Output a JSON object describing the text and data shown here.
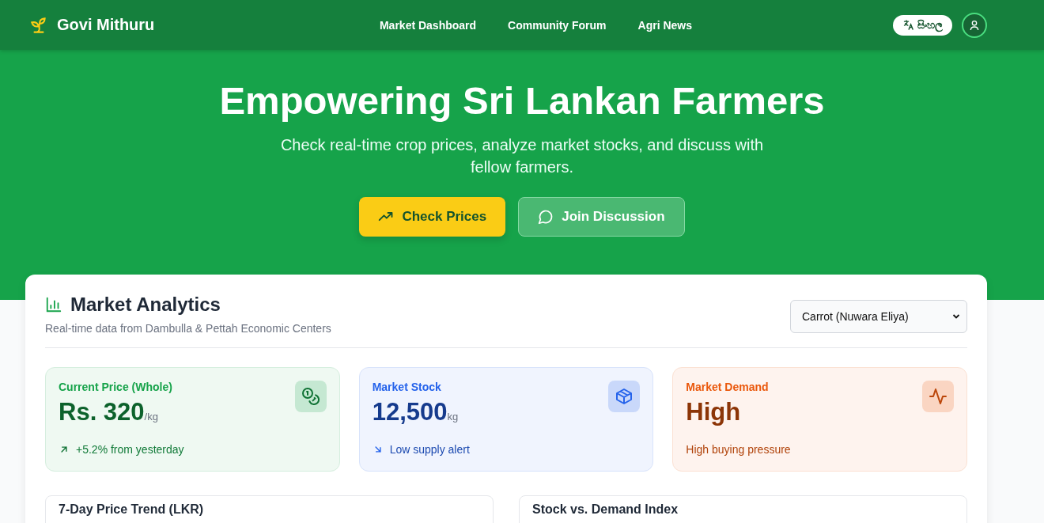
{
  "brand": "Govi Mithuru",
  "nav": [
    {
      "label": "Market Dashboard"
    },
    {
      "label": "Community Forum"
    },
    {
      "label": "Agri News"
    }
  ],
  "language_button": "සිංහල",
  "hero": {
    "title": "Empowering Sri Lankan Farmers",
    "subtitle": "Check real-time crop prices, analyze market stocks, and discuss with fellow farmers.",
    "buttons": [
      {
        "label": "Check Prices",
        "kind": "primary"
      },
      {
        "label": "Join Discussion",
        "kind": "secondary"
      }
    ]
  },
  "analytics": {
    "title": "Market Analytics",
    "subtitle": "Real-time data from Dambulla & Pettah Economic Centers",
    "crop_select": "Carrot (Nuwara Eliya)",
    "cards": [
      {
        "kind": "price",
        "label": "Current Price (Whole)",
        "value": "Rs. 320",
        "unit": "/kg",
        "note": "+5.2% from yesterday",
        "color": "#16a34a"
      },
      {
        "kind": "stock",
        "label": "Market Stock",
        "value": "12,500",
        "unit": "kg",
        "note": "Low supply alert",
        "color": "#2563eb"
      },
      {
        "kind": "demand",
        "label": "Market Demand",
        "value": "High",
        "note": "High buying pressure",
        "color": "#ea580c"
      }
    ],
    "panels": [
      {
        "title": "7-Day Price Trend (LKR)"
      },
      {
        "title": "Stock vs. Demand Index"
      }
    ]
  }
}
